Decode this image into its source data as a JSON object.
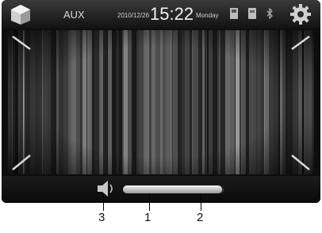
{
  "topbar": {
    "source": "AUX",
    "date": "2010/12/26",
    "time": "15:22",
    "day": "Monday",
    "icons": [
      "home-icon",
      "sd-card-icon",
      "usb-icon",
      "bluetooth-icon",
      "settings-gear-icon"
    ]
  },
  "volume": {
    "level": 0.98
  },
  "callouts": {
    "volume_icon": "3",
    "slider_track": "1",
    "slider_end": "2"
  },
  "colors": {
    "background": "#0d0d0d",
    "text": "#d8d8d8"
  }
}
